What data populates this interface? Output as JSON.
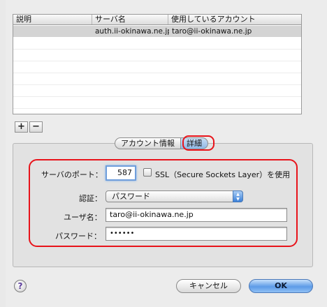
{
  "table": {
    "headers": [
      "説明",
      "サーバ名",
      "使用しているアカウント"
    ],
    "rows": [
      {
        "description": "",
        "server": "auth.ii-okinawa.ne.jp",
        "account": "taro@ii-okinawa.ne.jp"
      }
    ]
  },
  "controls": {
    "add_label": "+",
    "remove_label": "−"
  },
  "tabs": [
    {
      "label": "アカウント情報",
      "selected": false
    },
    {
      "label": "詳細",
      "selected": true
    }
  ],
  "form": {
    "port_label": "サーバのポート：",
    "port_value": "587",
    "ssl_label": "SSL（Secure Sockets Layer）を使用",
    "ssl_checked": false,
    "auth_label": "認証：",
    "auth_value": "パスワード",
    "username_label": "ユーザ名：",
    "username_value": "taro@ii-okinawa.ne.jp",
    "password_label": "パスワード：",
    "password_value": "••••••"
  },
  "footer": {
    "help_label": "?",
    "cancel_label": "キャンセル",
    "ok_label": "OK"
  },
  "colors": {
    "highlight_red": "#e8131a",
    "selected_row": "#d4d4d4",
    "accent_blue": "#5d9be7"
  }
}
